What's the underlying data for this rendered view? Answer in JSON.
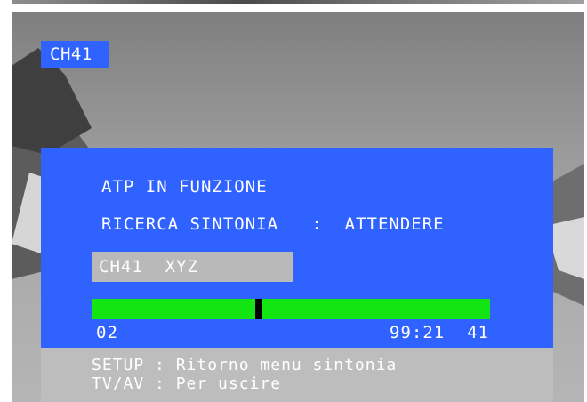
{
  "channel_badge": "CH41",
  "panel": {
    "status_line": "ATP IN FUNZIONE",
    "search_line": "RICERCA SINTONIA   :  ATTENDERE",
    "channel_box": "CH41  XYZ",
    "progress": {
      "marker_fraction": 0.42,
      "left_value": "02",
      "right_value": "99:21  41"
    }
  },
  "footer": {
    "line1": "SETUP : Ritorno menu sintonia",
    "line2": "TV/AV : Per uscire"
  },
  "colors": {
    "panel_blue": "#2f62ff",
    "progress_green": "#12e512",
    "box_grey": "#b9b9b9"
  }
}
